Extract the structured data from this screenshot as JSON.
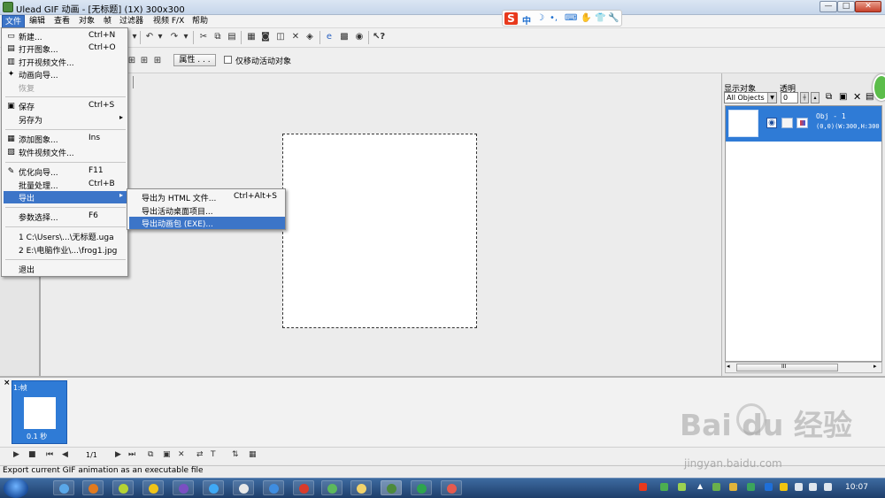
{
  "window": {
    "title": "Ulead GIF 动画 - [无标题] (1X) 300x300",
    "min_label": "—",
    "max_label": "□",
    "close_label": "✕"
  },
  "ime": {
    "logo": "S",
    "mode": "中",
    "glyphs": [
      "☽",
      "•,",
      "⌨",
      "✋",
      "👕",
      "🔧"
    ]
  },
  "menubar": {
    "items": [
      "文件",
      "编辑",
      "查看",
      "对象",
      "帧",
      "过滤器",
      "视频 F/X",
      "帮助"
    ]
  },
  "toolbar2": {
    "props_label": "属性 . . .",
    "move_only_label": "仅移动活动对象"
  },
  "file_menu": {
    "items": [
      {
        "label": "新建...",
        "shortcut": "Ctrl+N",
        "icon": "new-doc-icon",
        "glyph": "▭"
      },
      {
        "label": "打开图象...",
        "shortcut": "Ctrl+O",
        "icon": "open-image-icon",
        "glyph": "▤"
      },
      {
        "label": "打开视频文件...",
        "shortcut": "",
        "icon": "open-video-icon",
        "glyph": "▥"
      },
      {
        "label": "动画向导...",
        "shortcut": "",
        "icon": "wizard-icon",
        "glyph": "✦"
      },
      {
        "label": "恢复",
        "shortcut": "",
        "icon": "",
        "glyph": ""
      },
      {
        "label": "保存",
        "shortcut": "Ctrl+S",
        "icon": "save-icon",
        "glyph": "▣"
      },
      {
        "label": "另存为",
        "shortcut": "",
        "icon": "",
        "glyph": ""
      },
      {
        "label": "添加图象...",
        "shortcut": "Ins",
        "icon": "add-image-icon",
        "glyph": "▦"
      },
      {
        "label": "软件视频文件...",
        "shortcut": "",
        "icon": "video-file-icon",
        "glyph": "▧"
      },
      {
        "label": "优化向导...",
        "shortcut": "F11",
        "icon": "optimize-icon",
        "glyph": "✎"
      },
      {
        "label": "批量处理...",
        "shortcut": "Ctrl+B",
        "icon": "",
        "glyph": ""
      },
      {
        "label": "导出",
        "shortcut": "",
        "icon": "",
        "glyph": ""
      },
      {
        "label": "参数选择...",
        "shortcut": "F6",
        "icon": "",
        "glyph": ""
      },
      {
        "label": "1 C:\\Users\\...\\无标题.uga",
        "shortcut": "",
        "icon": "",
        "glyph": ""
      },
      {
        "label": "2 E:\\电脑作业\\...\\frog1.jpg",
        "shortcut": "",
        "icon": "",
        "glyph": ""
      },
      {
        "label": "退出",
        "shortcut": "",
        "icon": "",
        "glyph": ""
      }
    ],
    "submenu_arrow": "▸"
  },
  "export_submenu": {
    "items": [
      {
        "label": "导出为 HTML 文件...",
        "shortcut": "Ctrl+Alt+S"
      },
      {
        "label": "导出活动桌面项目...",
        "shortcut": ""
      },
      {
        "label": "导出动画包 (EXE)...",
        "shortcut": ""
      }
    ]
  },
  "right_panel": {
    "show_label": "显示对象",
    "trans_label": "透明",
    "select_value": "All Objects",
    "trans_value": "0",
    "object_name": "Obj - 1",
    "object_info": "(0,0)(W:300,H:300",
    "scroll_grip": "III"
  },
  "frames": {
    "close": "×",
    "frame1_label": "1:帧",
    "frame1_delay": "0.1 秒"
  },
  "playback": {
    "counter": "1/1"
  },
  "status": {
    "text": "Export current GIF animation as an executable file"
  },
  "taskbar": {
    "clock": "10:07"
  },
  "watermark": {
    "brand": "Bai du 经验",
    "url": "jingyan.baidu.com"
  },
  "colors": {
    "selection": "#3c75c8",
    "panel_selection": "#2f7bd6",
    "taskbar": "#1e3e6a"
  }
}
